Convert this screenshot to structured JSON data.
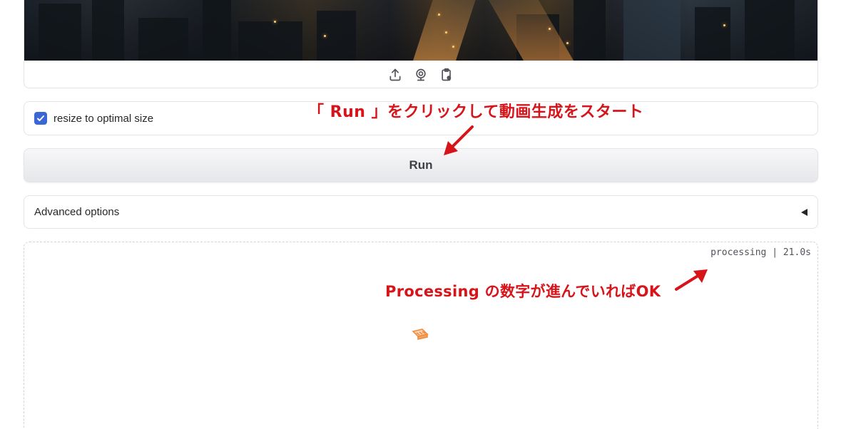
{
  "image_input": {
    "toolbar": [
      {
        "icon": "upload-icon"
      },
      {
        "icon": "webcam-icon"
      },
      {
        "icon": "clipboard-icon"
      }
    ]
  },
  "checkbox": {
    "label": "resize to optimal size",
    "checked": true,
    "color": "#3b66d6"
  },
  "run_button": {
    "label": "Run"
  },
  "advanced": {
    "label": "Advanced options",
    "icon": "caret-left-icon"
  },
  "output": {
    "status": "processing | 21.0s",
    "loader_icon": "loading-icon"
  },
  "annotations": {
    "run_hint": "「 Run 」をクリックして動画生成をスタート",
    "processing_hint": "Processing の数字が進んでいればOK",
    "color": "#d7141a"
  }
}
